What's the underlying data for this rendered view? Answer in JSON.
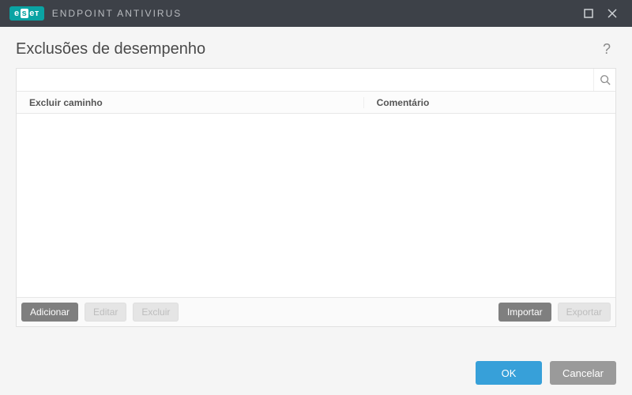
{
  "titlebar": {
    "brand_left": "e",
    "brand_mid": "s",
    "brand_right": "eт",
    "product": "ENDPOINT ANTIVIRUS"
  },
  "page": {
    "title": "Exclusões de desempenho",
    "help_glyph": "?"
  },
  "search": {
    "value": "",
    "placeholder": ""
  },
  "table": {
    "columns": {
      "path": "Excluir caminho",
      "comment": "Comentário"
    },
    "rows": []
  },
  "toolbar": {
    "add": "Adicionar",
    "edit": "Editar",
    "delete": "Excluir",
    "import": "Importar",
    "export": "Exportar"
  },
  "footer": {
    "ok": "OK",
    "cancel": "Cancelar"
  }
}
